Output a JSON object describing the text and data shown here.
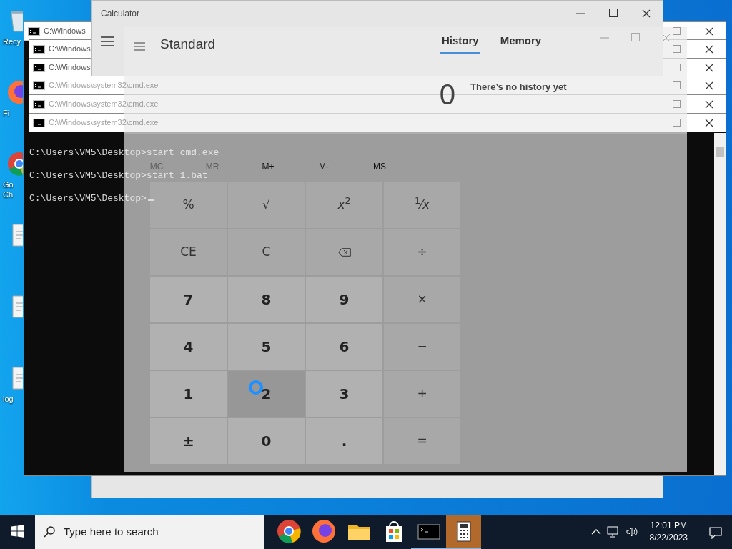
{
  "desktop_icons": [
    {
      "kind": "recycle",
      "label": "Recy"
    },
    {
      "kind": "firefox",
      "label": "Fi"
    },
    {
      "kind": "chrome",
      "label": "Go Ch"
    },
    {
      "kind": "file"
    },
    {
      "kind": "file"
    },
    {
      "kind": "file",
      "label": "log"
    }
  ],
  "cmd_windows": [
    {
      "title": "C:\\Windows"
    },
    {
      "title": "C:\\Windows"
    },
    {
      "title": "C:\\Windows"
    },
    {
      "title": "C:\\Windows\\system32\\cmd.exe"
    },
    {
      "title": "C:\\Windows\\system32\\cmd.exe"
    },
    {
      "title": "C:\\Windows\\system32\\cmd.exe"
    }
  ],
  "console": {
    "lines": [
      "C:\\Users\\VM5\\Desktop>start cmd.exe",
      "C:\\Users\\VM5\\Desktop>start 1.bat",
      "C:\\Users\\VM5\\Desktop>"
    ]
  },
  "calculator_window": {
    "title": "Calculator"
  },
  "calculator_overlay": {
    "mode": "Standard",
    "tabs": [
      {
        "label": "History",
        "selected": true
      },
      {
        "label": "Memory",
        "selected": false
      }
    ],
    "history_message": "There’s no history yet",
    "display": "0",
    "memory_buttons": [
      {
        "label": "MC",
        "disabled": true
      },
      {
        "label": "MR",
        "disabled": true
      },
      {
        "label": "M+",
        "disabled": false
      },
      {
        "label": "M-",
        "disabled": false
      },
      {
        "label": "MS",
        "disabled": false
      }
    ],
    "keys": [
      {
        "label": "%",
        "kind": "function"
      },
      {
        "label": "√",
        "kind": "function"
      },
      {
        "label": "*x*$^{2}$",
        "kind": "function"
      },
      {
        "label": "$^{1}$⁄*x*",
        "kind": "function"
      },
      {
        "label": "CE",
        "kind": "function"
      },
      {
        "label": "C",
        "kind": "function"
      },
      {
        "kind": "backspace"
      },
      {
        "label": "÷",
        "kind": "function"
      },
      {
        "label": "7",
        "kind": "digit"
      },
      {
        "label": "8",
        "kind": "digit"
      },
      {
        "label": "9",
        "kind": "digit"
      },
      {
        "label": "×",
        "kind": "function"
      },
      {
        "label": "4",
        "kind": "digit"
      },
      {
        "label": "5",
        "kind": "digit"
      },
      {
        "label": "6",
        "kind": "digit"
      },
      {
        "label": "−",
        "kind": "function"
      },
      {
        "label": "1",
        "kind": "digit"
      },
      {
        "label": "2",
        "kind": "digit",
        "hovered": true
      },
      {
        "label": "3",
        "kind": "digit"
      },
      {
        "label": "+",
        "kind": "function"
      },
      {
        "label": "±",
        "kind": "digit"
      },
      {
        "label": "0",
        "kind": "digit"
      },
      {
        "label": ".",
        "kind": "digit"
      },
      {
        "label": "=",
        "kind": "function"
      }
    ]
  },
  "taskbar": {
    "search": {
      "placeholder": "Type here to search"
    },
    "apps": [
      {
        "kind": "chrome",
        "running": false,
        "active": false
      },
      {
        "kind": "firefox",
        "running": false,
        "active": false
      },
      {
        "kind": "folder",
        "running": false,
        "active": false
      },
      {
        "kind": "store",
        "running": false,
        "active": false
      },
      {
        "kind": "console",
        "running": true,
        "active": false
      },
      {
        "kind": "calculator",
        "running": true,
        "active": true
      }
    ],
    "time": "12:01 PM",
    "date": "8/22/2023"
  }
}
